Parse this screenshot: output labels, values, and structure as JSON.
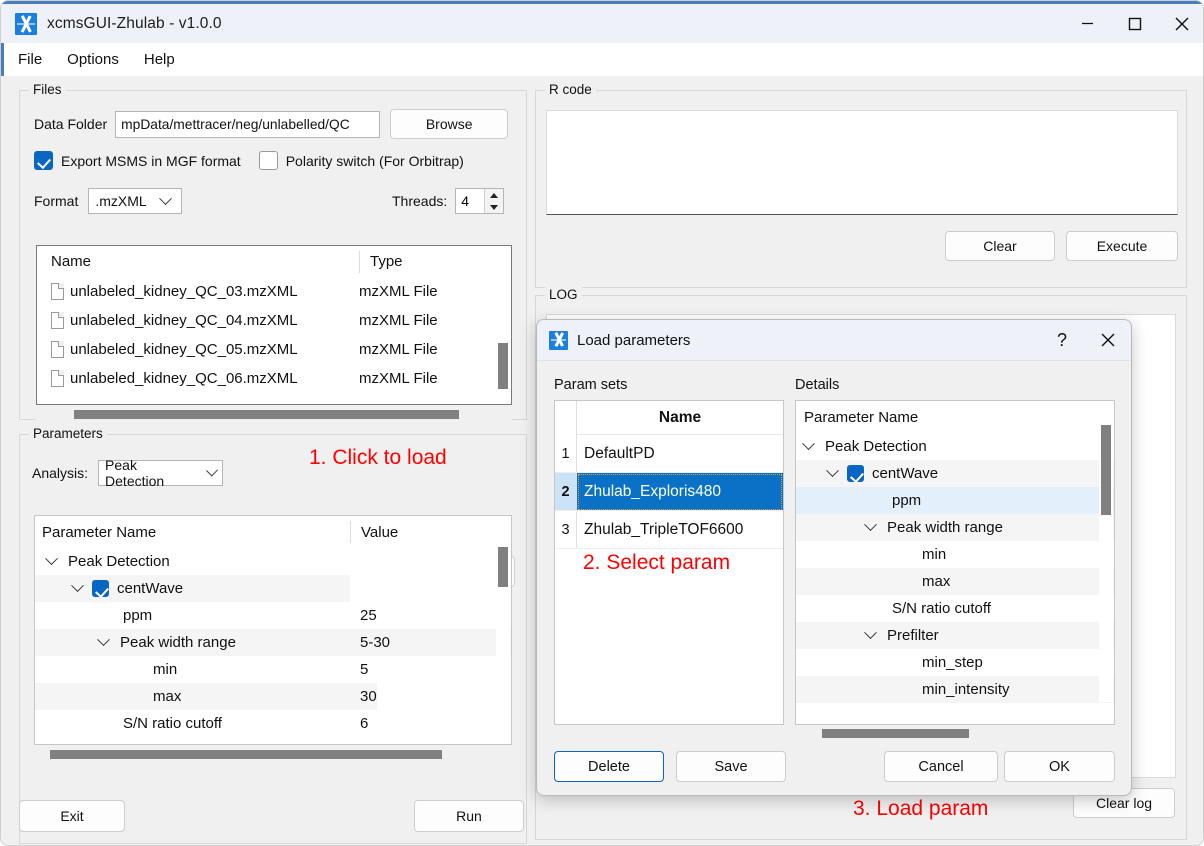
{
  "window": {
    "title": "xcmsGUI-Zhulab - v1.0.0",
    "icon": "app-logo-icon",
    "controls": {
      "minimize": "minimize-icon",
      "maximize": "maximize-icon",
      "close": "close-icon"
    }
  },
  "menubar": {
    "items": [
      "File",
      "Options",
      "Help"
    ]
  },
  "files_group": {
    "title": "Files",
    "data_folder_label": "Data Folder",
    "data_folder_value": "mpData/mettracer/neg/unlabelled/QC",
    "browse_label": "Browse",
    "export_msms": {
      "label": "Export MSMS in MGF format",
      "checked": true
    },
    "polarity_switch": {
      "label": "Polarity switch (For Orbitrap)",
      "checked": false
    },
    "format_label": "Format",
    "format_value": ".mzXML",
    "threads_label": "Threads:",
    "threads_value": "4",
    "table": {
      "columns": [
        "Name",
        "Type"
      ],
      "rows": [
        {
          "name": "unlabeled_kidney_QC_03.mzXML",
          "type": "mzXML File"
        },
        {
          "name": "unlabeled_kidney_QC_04.mzXML",
          "type": "mzXML File"
        },
        {
          "name": "unlabeled_kidney_QC_05.mzXML",
          "type": "mzXML File"
        },
        {
          "name": "unlabeled_kidney_QC_06.mzXML",
          "type": "mzXML File"
        }
      ]
    }
  },
  "parameters_group": {
    "title": "Parameters",
    "analysis_label": "Analysis:",
    "analysis_value": "Peak Detection",
    "load_icon": "open-folder-icon",
    "save_icon": "save-disk-icon",
    "table": {
      "columns": [
        "Parameter Name",
        "Value"
      ],
      "rows": [
        {
          "name": "Peak Detection",
          "value": "",
          "indent": 0,
          "expander": true,
          "checkbox": null
        },
        {
          "name": "centWave",
          "value": "",
          "indent": 1,
          "expander": true,
          "checkbox": true
        },
        {
          "name": "ppm",
          "value": "25",
          "indent": 2,
          "expander": false,
          "checkbox": null
        },
        {
          "name": "Peak width range",
          "value": "5-30",
          "indent": 2,
          "expander": true,
          "checkbox": null
        },
        {
          "name": "min",
          "value": "5",
          "indent": 3,
          "expander": false,
          "checkbox": null
        },
        {
          "name": "max",
          "value": "30",
          "indent": 3,
          "expander": false,
          "checkbox": null
        },
        {
          "name": "S/N ratio cutoff",
          "value": "6",
          "indent": 2,
          "expander": false,
          "checkbox": null
        }
      ]
    }
  },
  "rcode_group": {
    "title": "R code",
    "editor_value": "",
    "clear_label": "Clear",
    "execute_label": "Execute"
  },
  "log_group": {
    "title": "LOG",
    "log_value": "",
    "clear_log_label": "Clear log"
  },
  "footer": {
    "exit_label": "Exit",
    "run_label": "Run"
  },
  "dialog": {
    "title": "Load parameters",
    "icon": "app-logo-icon",
    "help_label": "?",
    "close_icon": "close-icon",
    "param_sets_label": "Param sets",
    "details_label": "Details",
    "param_sets": {
      "column": "Name",
      "rows": [
        {
          "index": "1",
          "name": "DefaultPD",
          "selected": false
        },
        {
          "index": "2",
          "name": "Zhulab_Exploris480",
          "selected": true
        },
        {
          "index": "3",
          "name": "Zhulab_TripleTOF6600",
          "selected": false
        }
      ]
    },
    "details": {
      "column": "Parameter Name",
      "rows": [
        {
          "name": "Peak Detection",
          "indent": 0,
          "expander": true,
          "checkbox": null,
          "highlight": "none"
        },
        {
          "name": "centWave",
          "indent": 1,
          "expander": true,
          "checkbox": true,
          "highlight": "alt"
        },
        {
          "name": "ppm",
          "indent": 2,
          "expander": false,
          "checkbox": null,
          "highlight": "selected"
        },
        {
          "name": "Peak width range",
          "indent": 2,
          "expander": true,
          "checkbox": null,
          "highlight": "alt"
        },
        {
          "name": "min",
          "indent": 3,
          "expander": false,
          "checkbox": null,
          "highlight": "none"
        },
        {
          "name": "max",
          "indent": 3,
          "expander": false,
          "checkbox": null,
          "highlight": "alt"
        },
        {
          "name": "S/N ratio cutoff",
          "indent": 2,
          "expander": false,
          "checkbox": null,
          "highlight": "none"
        },
        {
          "name": "Prefilter",
          "indent": 2,
          "expander": true,
          "checkbox": null,
          "highlight": "alt"
        },
        {
          "name": "min_step",
          "indent": 3,
          "expander": false,
          "checkbox": null,
          "highlight": "none"
        },
        {
          "name": "min_intensity",
          "indent": 3,
          "expander": false,
          "checkbox": null,
          "highlight": "alt"
        }
      ]
    },
    "buttons": {
      "delete": "Delete",
      "save": "Save",
      "cancel": "Cancel",
      "ok": "OK"
    }
  },
  "annotations": {
    "step1": "1. Click to load",
    "step2": "2. Select param",
    "step3": "3. Load param",
    "color": "#ff0000"
  }
}
